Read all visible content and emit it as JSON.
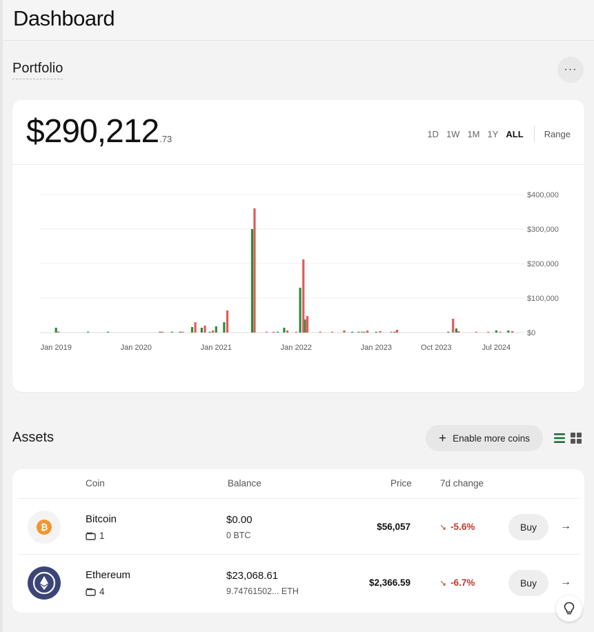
{
  "header": {
    "title": "Dashboard"
  },
  "portfolio": {
    "title": "Portfolio",
    "more_label": "···",
    "balance_main": "$290,212",
    "balance_cents": ".73",
    "range_tabs": [
      "1D",
      "1W",
      "1M",
      "1Y",
      "ALL"
    ],
    "active_range": "ALL",
    "range_button": "Range"
  },
  "colors": {
    "inflow": "#2e8b3a",
    "outflow": "#e05a5a",
    "accent_green": "#1e6b3a",
    "negative": "#c0392b",
    "bitcoin": "#f2952f",
    "ethereum": "#3c4578"
  },
  "chart_data": {
    "type": "bar",
    "ylabel_ticks": [
      "$0",
      "$100,000",
      "$200,000",
      "$300,000",
      "$400,000"
    ],
    "ylim": [
      0,
      400000
    ],
    "x_tick_labels": [
      "Jan 2019",
      "Jan 2020",
      "Jan 2021",
      "Jan 2022",
      "Jan 2023",
      "Oct 2023",
      "Jul 2024"
    ],
    "grid": true,
    "series": [
      {
        "color": "#2e8b3a",
        "points": [
          [
            2019.0,
            14000
          ],
          [
            2019.4,
            2000
          ],
          [
            2019.65,
            2000
          ],
          [
            2020.3,
            2000
          ],
          [
            2020.45,
            2000
          ],
          [
            2020.55,
            2000
          ],
          [
            2020.7,
            16000
          ],
          [
            2020.82,
            14000
          ],
          [
            2020.92,
            2000
          ],
          [
            2021.0,
            18000
          ],
          [
            2021.1,
            30000
          ],
          [
            2021.45,
            300000
          ],
          [
            2021.77,
            2000
          ],
          [
            2021.85,
            14000
          ],
          [
            2022.05,
            130000
          ],
          [
            2022.11,
            38000
          ],
          [
            2022.7,
            2000
          ],
          [
            2022.78,
            2000
          ],
          [
            2022.85,
            2000
          ],
          [
            2023.0,
            2000
          ],
          [
            2023.23,
            2000
          ],
          [
            2023.9,
            2000
          ],
          [
            2024.0,
            12000
          ],
          [
            2024.5,
            6000
          ],
          [
            2024.65,
            6000
          ]
        ]
      },
      {
        "color": "#e05a5a",
        "points": [
          [
            2019.03,
            3000
          ],
          [
            2020.33,
            2000
          ],
          [
            2020.58,
            2000
          ],
          [
            2020.74,
            30000
          ],
          [
            2020.86,
            20000
          ],
          [
            2020.96,
            6000
          ],
          [
            2021.14,
            64000
          ],
          [
            2021.48,
            360000
          ],
          [
            2021.63,
            2000
          ],
          [
            2021.72,
            2000
          ],
          [
            2021.89,
            6000
          ],
          [
            2022.0,
            2000
          ],
          [
            2022.09,
            212000
          ],
          [
            2022.14,
            48000
          ],
          [
            2022.3,
            2000
          ],
          [
            2022.45,
            2000
          ],
          [
            2022.6,
            6000
          ],
          [
            2022.82,
            2000
          ],
          [
            2022.89,
            6000
          ],
          [
            2023.05,
            4000
          ],
          [
            2023.19,
            2000
          ],
          [
            2023.26,
            8000
          ],
          [
            2023.96,
            40000
          ],
          [
            2024.03,
            4000
          ],
          [
            2024.25,
            2000
          ],
          [
            2024.4,
            2000
          ],
          [
            2024.55,
            2000
          ],
          [
            2024.7,
            4000
          ]
        ]
      }
    ]
  },
  "assets": {
    "title": "Assets",
    "enable_button": "Enable more coins",
    "columns": {
      "coin": "Coin",
      "balance": "Balance",
      "price": "Price",
      "change": "7d change"
    },
    "rows": [
      {
        "name": "Bitcoin",
        "wallets": "1",
        "balance_usd": "$0.00",
        "balance_coin": "0 BTC",
        "price": "$56,057",
        "change": "-5.6%",
        "buy_label": "Buy"
      },
      {
        "name": "Ethereum",
        "wallets": "4",
        "balance_usd": "$23,068.61",
        "balance_coin": "9.74761502... ETH",
        "price": "$2,366.59",
        "change": "-6.7%",
        "buy_label": "Buy"
      }
    ]
  },
  "icons": {
    "list_view": "list-view-icon",
    "grid_view": "grid-view-icon",
    "help": "lightbulb-icon",
    "wallet": "wallet-icon",
    "arrow": "arrow-right-icon",
    "trend": "trend-down-icon"
  }
}
